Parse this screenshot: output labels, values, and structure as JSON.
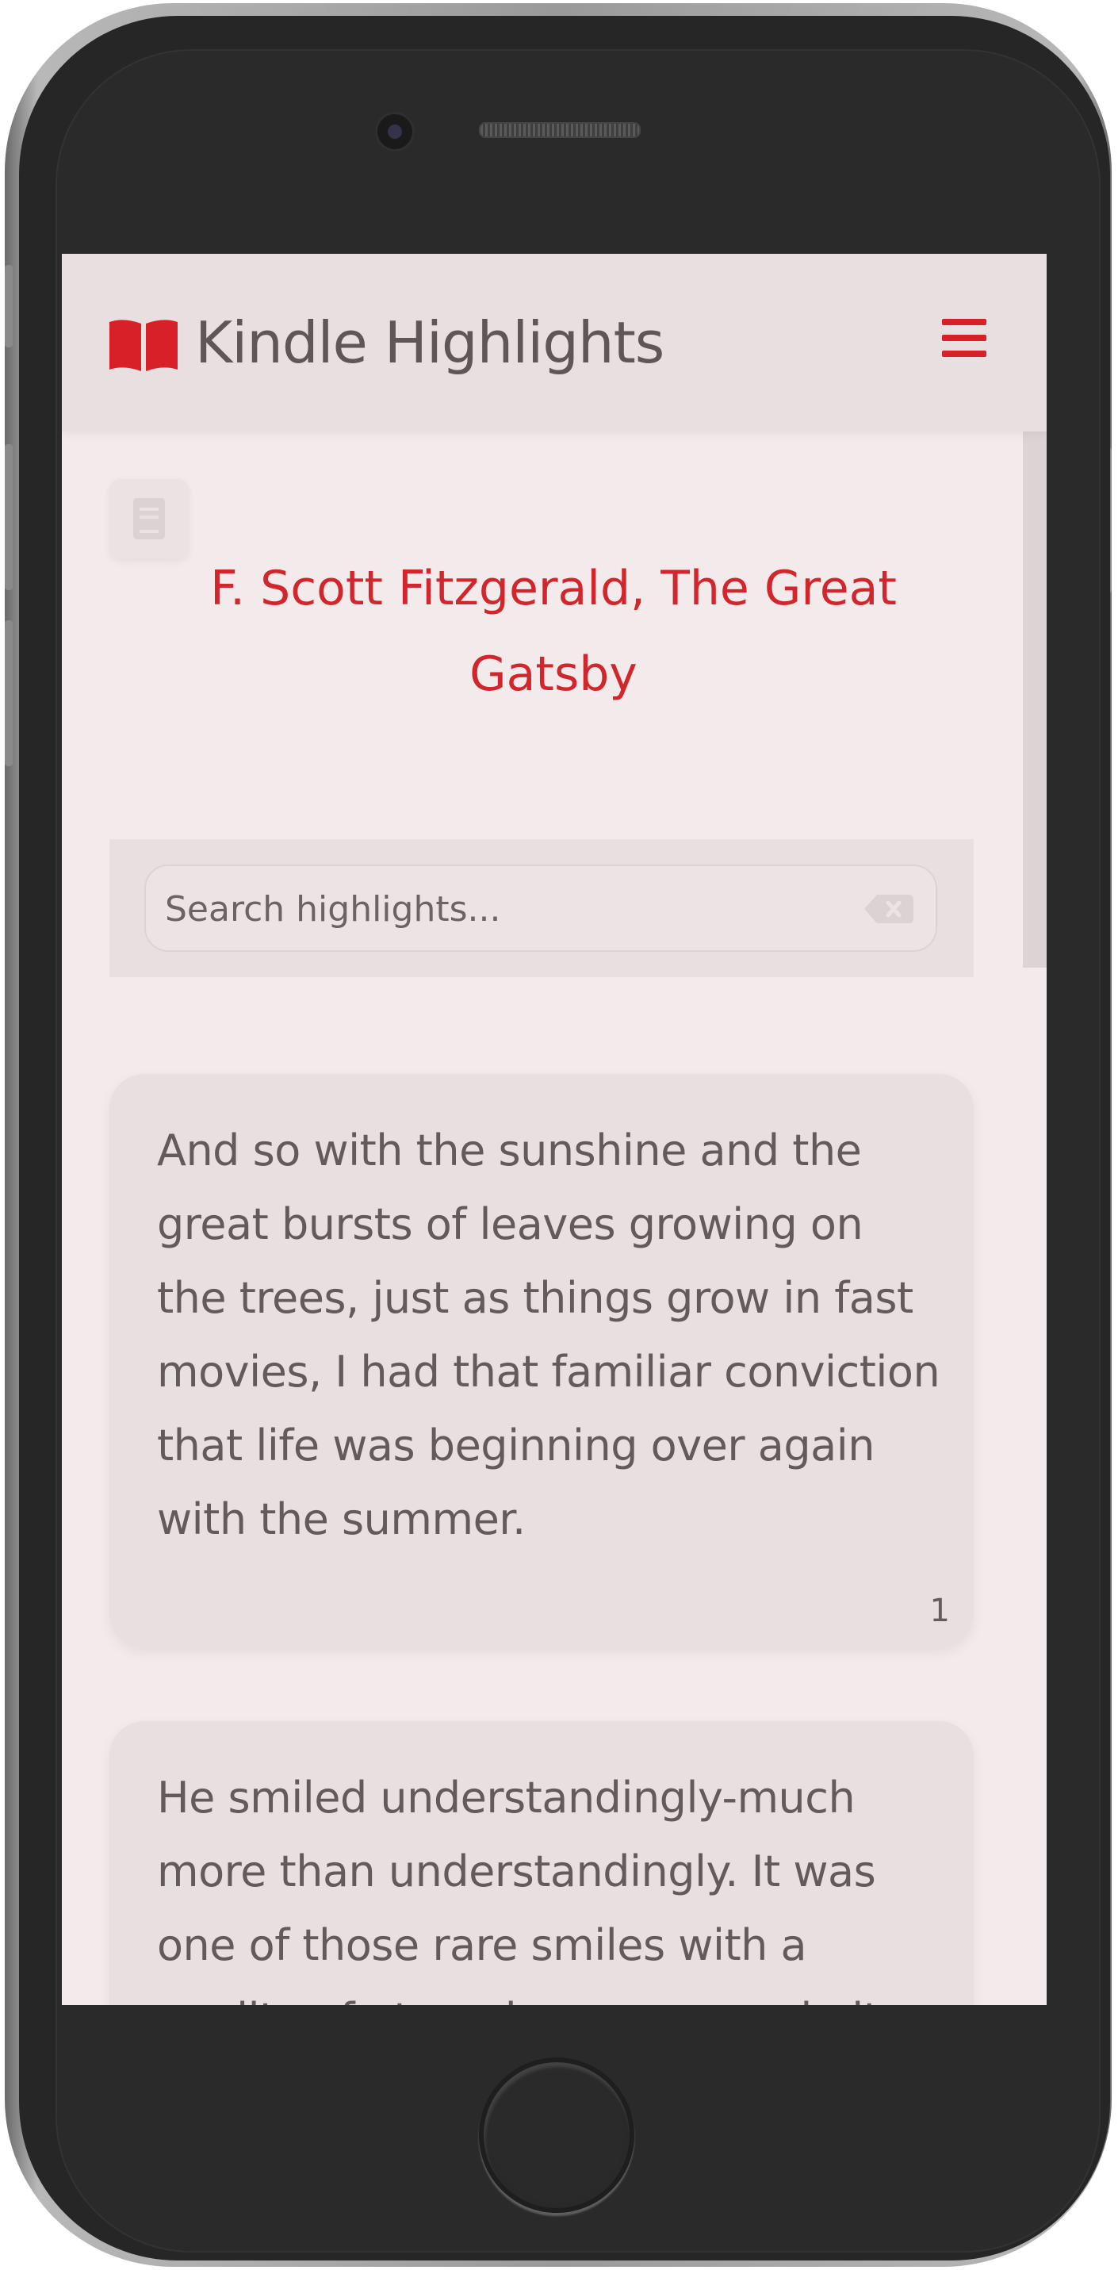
{
  "app": {
    "title": "Kindle Highlights",
    "brand_icon": "book-open-icon",
    "menu_icon": "hamburger-menu-icon"
  },
  "book": {
    "title": "F. Scott Fitzgerald, The Great Gatsby",
    "icon": "book-icon"
  },
  "search": {
    "placeholder": "Search highlights...",
    "value": "",
    "clear_icon": "backspace-clear-icon"
  },
  "highlights": [
    {
      "text": "And so with the sunshine and the great bursts of leaves growing on the trees, just as things grow in fast movies, I had that familiar conviction that life was beginning over again with the summer.",
      "number": "1"
    },
    {
      "text": "He smiled understandingly-much more than understandingly. It was one of those rare smiles with a quality of eternal reassurance in it",
      "number": ""
    }
  ],
  "colors": {
    "accent": "#d72027",
    "navbar": "#e8dfe0",
    "background": "#f3eaec",
    "text": "#625a5b"
  }
}
